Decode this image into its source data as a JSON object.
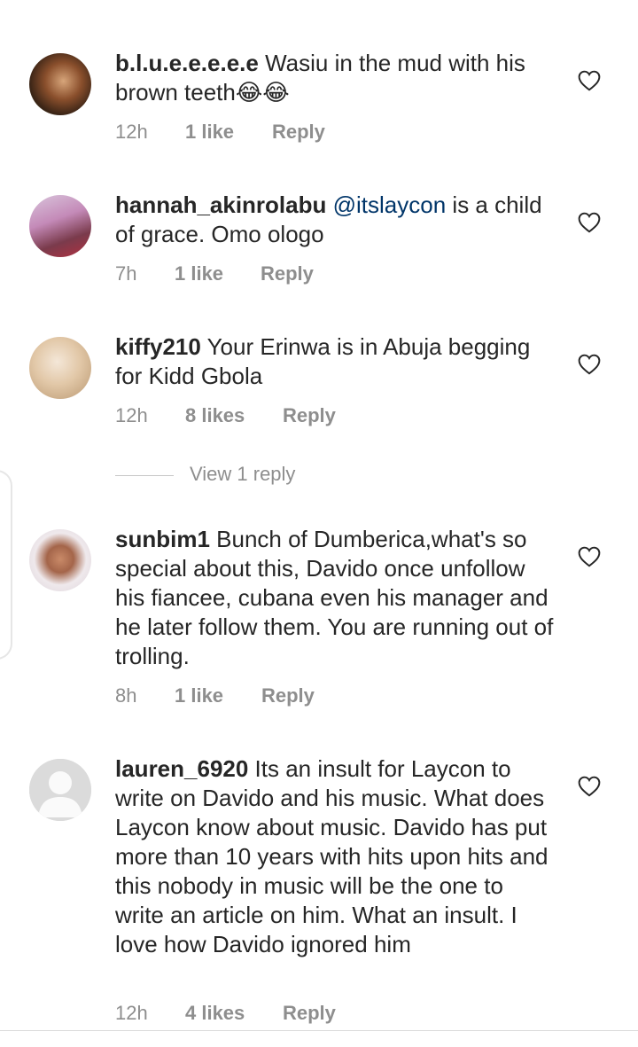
{
  "comments": [
    {
      "username": "b.l.u.e.e.e.e.e",
      "mention": "",
      "text": " Wasiu in the mud with his brown teeth😂😂",
      "time": "12h",
      "likes": "1 like",
      "reply": "Reply"
    },
    {
      "username": "hannah_akinrolabu",
      "mention": "@itslaycon",
      "text": " is a child of grace. Omo ologo",
      "time": "7h",
      "likes": "1 like",
      "reply": "Reply"
    },
    {
      "username": "kiffy210",
      "mention": "",
      "text": " Your Erinwa is in Abuja begging for Kidd Gbola",
      "time": "12h",
      "likes": "8 likes",
      "reply": "Reply"
    },
    {
      "username": "sunbim1",
      "mention": "",
      "text": " Bunch of Dumberica,what's so special about this, Davido once unfollow his fiancee, cubana even his manager and he later follow them. You are running out of trolling.",
      "time": "8h",
      "likes": "1 like",
      "reply": "Reply"
    },
    {
      "username": "lauren_6920",
      "mention": "",
      "text": " Its an insult for Laycon to write on Davido and his music. What does Laycon know about music. Davido has put more than 10 years with hits upon hits and this nobody in music will be the one to write an article on him. What an insult. I love how Davido ignored him",
      "time": "12h",
      "likes": "4 likes",
      "reply": "Reply"
    }
  ],
  "view_replies": "View 1 reply",
  "icons": {
    "like": "heart-outline-icon",
    "avatar_placeholder": "default-avatar-icon"
  },
  "colors": {
    "text": "#262626",
    "meta": "#8e8e8e",
    "mention": "#003569"
  }
}
